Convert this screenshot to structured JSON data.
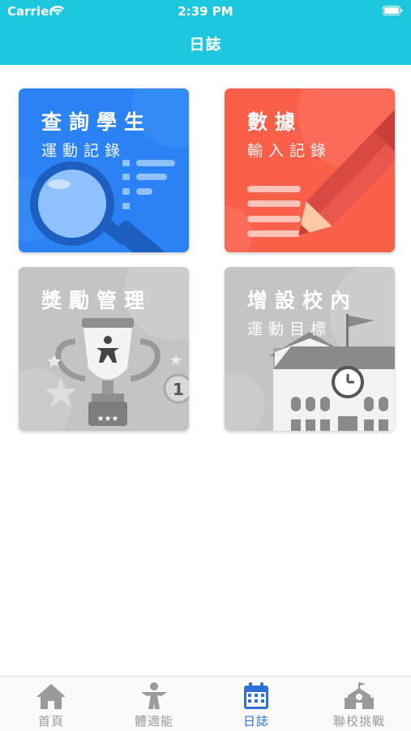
{
  "status_bar": {
    "carrier": "Carrier",
    "time": "2:39 PM"
  },
  "nav": {
    "title": "日誌"
  },
  "tiles": [
    {
      "title": "查詢學生",
      "subtitle": "運動記錄",
      "color": "#2a82f4"
    },
    {
      "title": "數據",
      "subtitle": "輸入記錄",
      "color": "#f9604a"
    },
    {
      "title": "獎勵管理",
      "subtitle": "",
      "color": "#c4c4c4"
    },
    {
      "title": "增設校內",
      "subtitle": "運動目標",
      "color": "#c4c4c4"
    }
  ],
  "tabs": [
    {
      "label": "首頁",
      "icon": "home-icon"
    },
    {
      "label": "體適能",
      "icon": "person-exercise-icon"
    },
    {
      "label": "日誌",
      "icon": "calendar-icon",
      "active": true
    },
    {
      "label": "聯校挑戰",
      "icon": "school-building-icon"
    }
  ],
  "colors": {
    "header": "#1cc6df",
    "active_tab": "#2f6fd8",
    "inactive_tab": "#9a9a9a"
  }
}
